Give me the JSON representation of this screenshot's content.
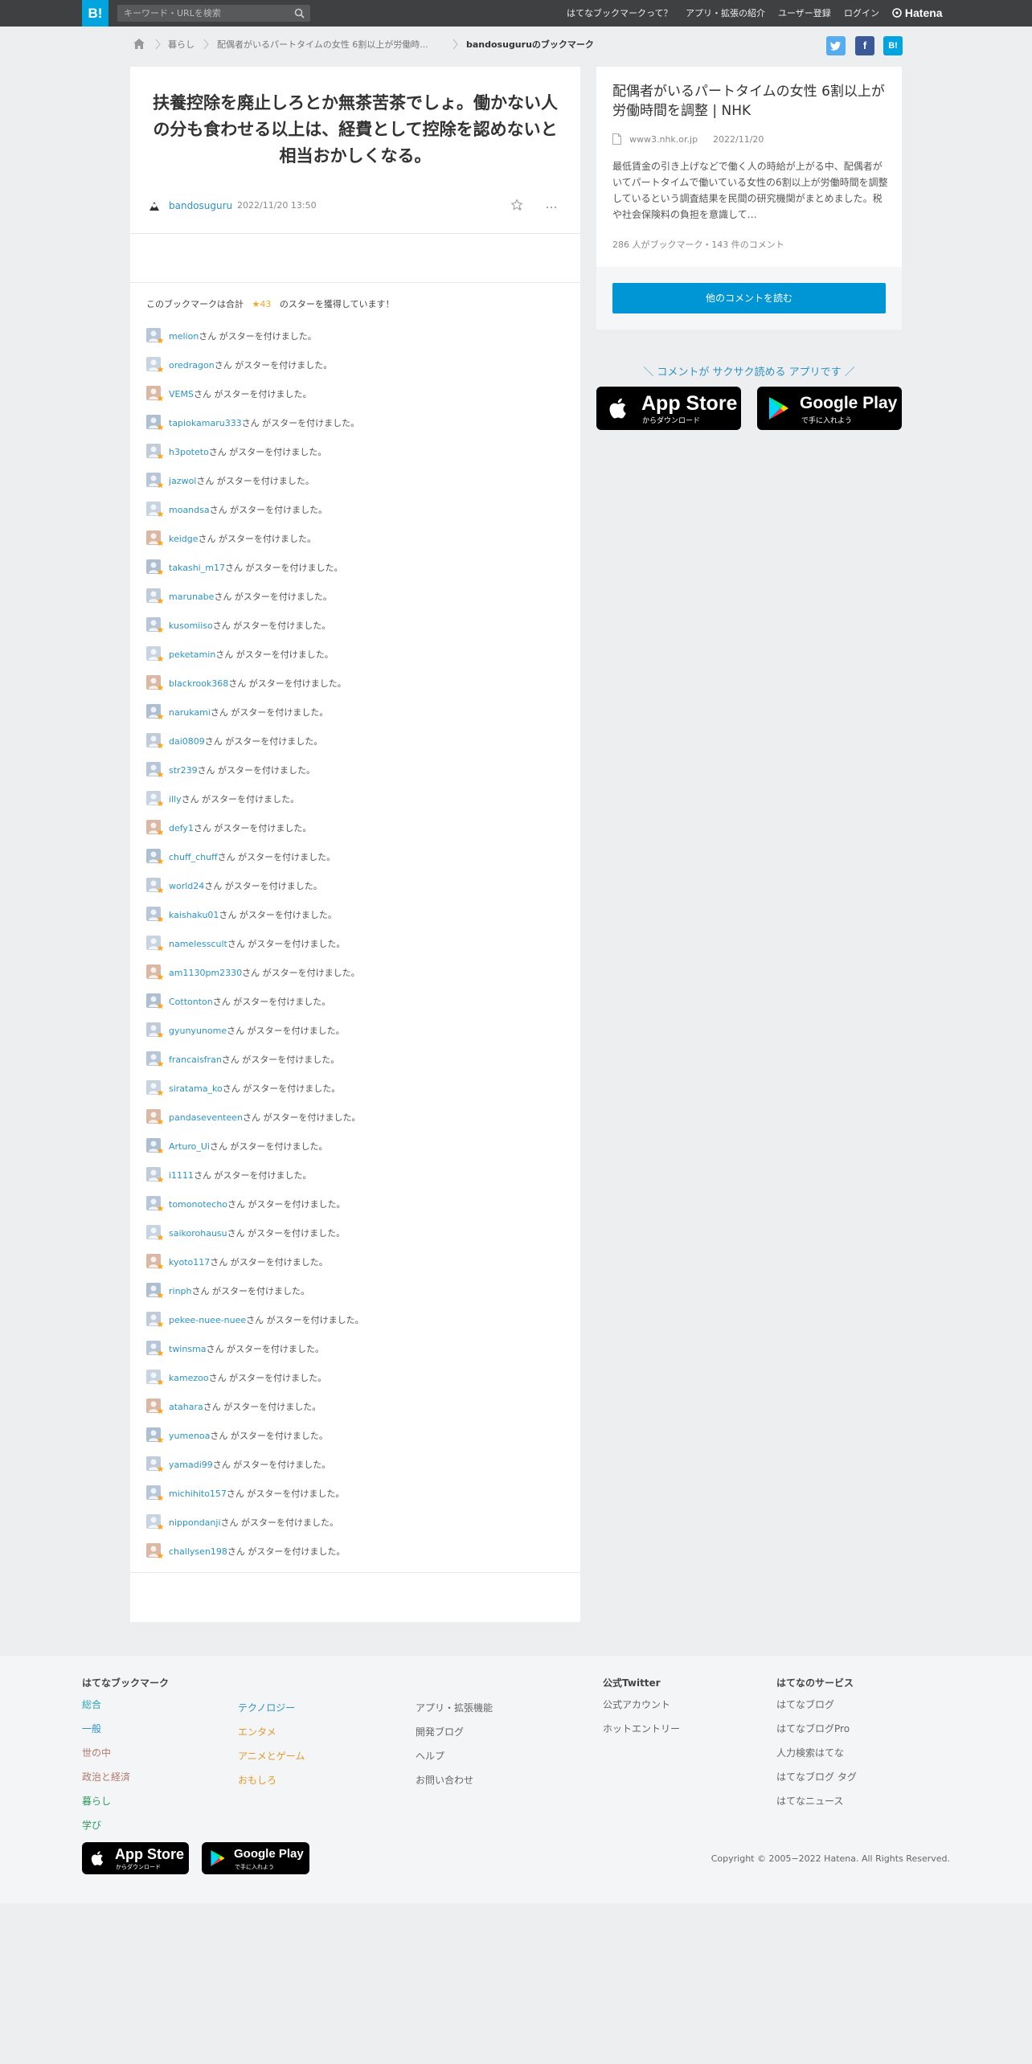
{
  "header": {
    "logo": "B!",
    "search_placeholder": "キーワード・URLを検索",
    "nav": [
      "はてなブックマークって？",
      "アプリ・拡張の紹介",
      "ユーザー登録",
      "ログイン"
    ],
    "brand": "Hatena"
  },
  "breadcrumb": {
    "items": [
      "暮らし",
      "配偶者がいるパートタイムの女性 6割以上が労働時..."
    ],
    "current": "bandosuguruのブックマーク"
  },
  "share": [
    "twitter",
    "facebook",
    "hatena"
  ],
  "comment": {
    "text": "扶養控除を廃止しろとか無茶苦茶でしょ。働かない人の分も食わせる以上は、経費として控除を認めないと相当おかしくなる。",
    "author": "bandosuguru",
    "datetime": "2022/11/20 13:50",
    "more": "…"
  },
  "stars": {
    "summary_prefix": "このブックマークは合計",
    "summary_count": "★43",
    "summary_suffix": "のスターを獲得しています！",
    "suffix": "さん がスターを付けました。",
    "users": [
      "melion",
      "oredragon",
      "VEMS",
      "tapiokamaru333",
      "h3poteto",
      "jazwol",
      "moandsa",
      "keidge",
      "takashi_m17",
      "marunabe",
      "kusomiiso",
      "peketamin",
      "blackrook368",
      "narukami",
      "dai0809",
      "str239",
      "illy",
      "defy1",
      "chuff_chuff",
      "world24",
      "kaishaku01",
      "namelesscult",
      "am1130pm2330",
      "Cottonton",
      "gyunyunome",
      "francaisfran",
      "siratama_ko",
      "pandaseventeen",
      "Arturo_Ui",
      "i1111",
      "tomonotecho",
      "saikorohausu",
      "kyoto117",
      "rinph",
      "pekee-nuee-nuee",
      "twinsma",
      "kamezoo",
      "atahara",
      "yumenoa",
      "yamadi99",
      "michihito157",
      "nippondanji",
      "challysen198"
    ]
  },
  "entry": {
    "title": "配偶者がいるパートタイムの女性 6割以上が労働時間を調整 | NHK",
    "domain": "www3.nhk.or.jp",
    "date": "2022/11/20",
    "description": "最低賃金の引き上げなどで働く人の時給が上がる中、配偶者がいてパートタイムで働いている女性の6割以上が労働時間を調整しているという調査結果を民間の研究機関がまとめました。税や社会保険料の負担を意識して…",
    "stats": "286 人がブックマーク・143 件のコメント",
    "read_button": "他のコメントを読む"
  },
  "app_promo": "＼ コメントが サクサク読める アプリです ／",
  "app_store": {
    "big": "App Store",
    "small": "からダウンロード"
  },
  "google_play": {
    "big": "Google Play",
    "small": "で手に入れよう"
  },
  "footer": {
    "heading": "はてなブックマーク",
    "cat1": [
      "総合",
      "一般",
      "世の中",
      "政治と経済",
      "暮らし",
      "学び"
    ],
    "cat2": [
      "テクノロジー",
      "エンタメ",
      "アニメとゲーム",
      "おもしろ"
    ],
    "misc": [
      "アプリ・拡張機能",
      "開発ブログ",
      "ヘルプ",
      "お問い合わせ"
    ],
    "twitter_heading": "公式Twitter",
    "twitter": [
      "公式アカウント",
      "ホットエントリー"
    ],
    "services_heading": "はてなのサービス",
    "services": [
      "はてなブログ",
      "はてなブログPro",
      "人力検索はてな",
      "はてなブログ タグ",
      "はてなニュース"
    ],
    "copyright": "Copyright © 2005−2022 Hatena. All Rights Reserved."
  },
  "colors": {
    "accent": "#00a4de",
    "link": "#2d92c6",
    "star": "#f5a623",
    "cat_general": "#2aa3b8",
    "cat_society": "#b0786c",
    "cat_life": "#2e9b5f",
    "cat_tech": "#2d92c6",
    "cat_ent": "#e39a2c"
  }
}
